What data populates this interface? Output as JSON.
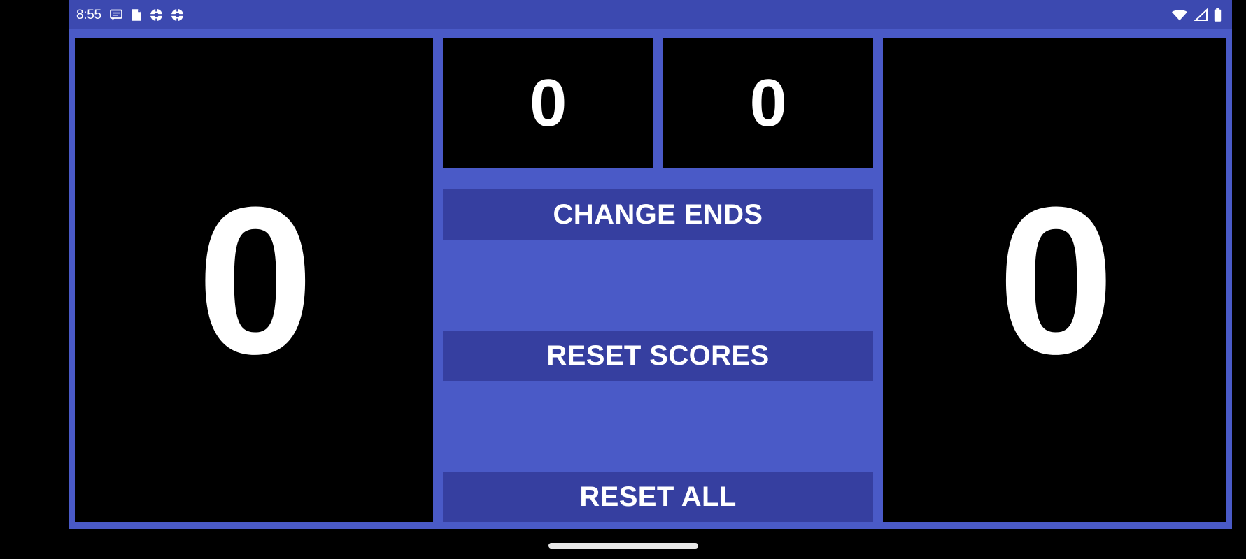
{
  "status_bar": {
    "time": "8:55",
    "left_icons": [
      "chat-bubble-icon",
      "clipboard-icon",
      "gear-icon",
      "gear-icon"
    ],
    "right_icons": [
      "wifi-icon",
      "cell-signal-icon",
      "battery-icon"
    ],
    "background_color": "#3C49B0",
    "foreground_color": "#FFFFFF"
  },
  "app": {
    "background_color": "#4A5AC7",
    "panel_color": "#000000",
    "button_color": "#363FA0",
    "score_text_color": "#FFFFFF"
  },
  "scoreboard": {
    "left_player_score": "0",
    "right_player_score": "0",
    "left_games_won": "0",
    "right_games_won": "0"
  },
  "controls": {
    "change_ends_label": "CHANGE ENDS",
    "reset_scores_label": "RESET SCORES",
    "reset_all_label": "RESET ALL"
  },
  "navigation_bar": {
    "home_pill": ""
  }
}
